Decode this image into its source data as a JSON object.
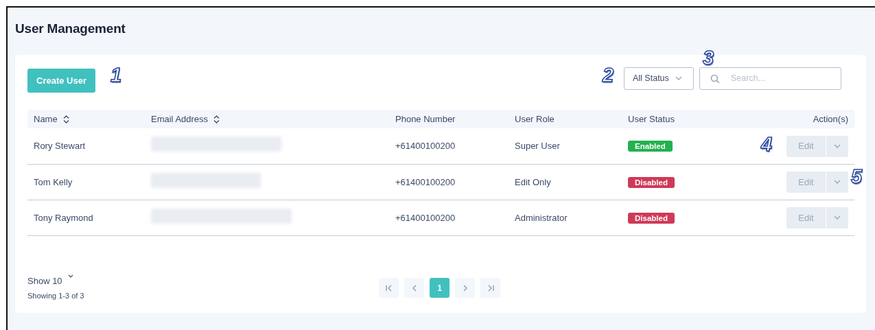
{
  "page": {
    "title": "User Management"
  },
  "toolbar": {
    "create_button": "Create User",
    "status_filter": "All Status",
    "search": {
      "placeholder": "Search..."
    }
  },
  "table": {
    "columns": [
      {
        "label": "Name",
        "sortable": true
      },
      {
        "label": "Email Address",
        "sortable": true
      },
      {
        "label": "Phone Number",
        "sortable": false
      },
      {
        "label": "User Role",
        "sortable": false
      },
      {
        "label": "User Status",
        "sortable": false
      },
      {
        "label": "Action(s)",
        "sortable": false
      }
    ],
    "rows": [
      {
        "name": "Rory Stewart",
        "email": {
          "kind": "blurred"
        },
        "phone": "+61400100200",
        "role": "Super User",
        "status": {
          "label": "Enabled",
          "kind": "enabled"
        },
        "action": "Edit"
      },
      {
        "name": "Tom Kelly",
        "email": {
          "kind": "blurred"
        },
        "phone": "+61400100200",
        "role": "Edit Only",
        "status": {
          "label": "Disabled",
          "kind": "disabled"
        },
        "action": "Edit"
      },
      {
        "name": "Tony Raymond",
        "email": {
          "kind": "blurred"
        },
        "phone": "+61400100200",
        "role": "Administrator",
        "status": {
          "label": "Disabled",
          "kind": "disabled"
        },
        "action": "Edit"
      }
    ]
  },
  "footer": {
    "page_size": "Show 10",
    "summary": "Showing 1-3 of 3",
    "pages": [
      {
        "label": "1",
        "selected": true
      }
    ]
  },
  "callouts": [
    "1",
    "2",
    "3",
    "4",
    "5"
  ]
}
